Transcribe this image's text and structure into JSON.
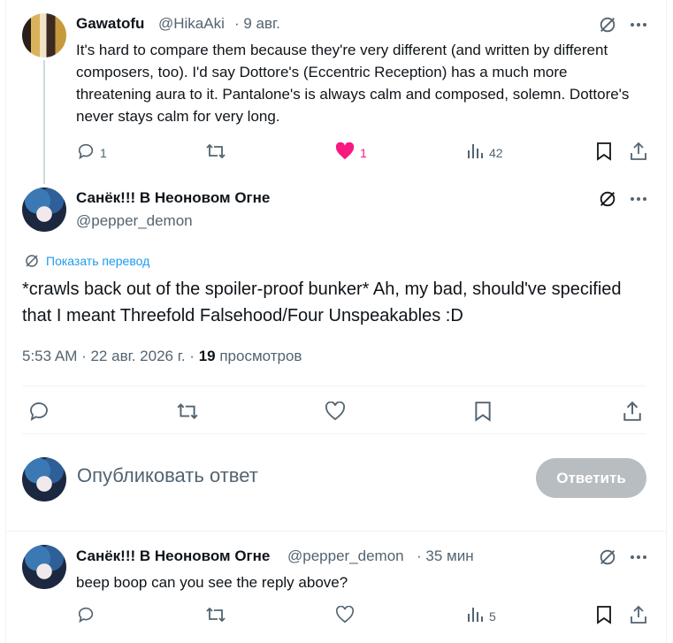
{
  "tweet1": {
    "name": "Gawatofu",
    "handle": "@HikaAki",
    "date": "· 9 авг.",
    "text": "It's hard to compare them because they're very different (and written by different composers, too). I'd say Dottore's (Eccentric Reception) has a much more threatening aura to it. Pantalone's is always calm and composed, solemn. Dottore's never stays calm for very long.",
    "replies": "1",
    "likes": "1",
    "views": "42"
  },
  "main_tweet": {
    "name": "Санёк!!! В Неоновом Огне",
    "handle": "@pepper_demon",
    "translate_label": "Показать перевод",
    "text": "*crawls back out of the spoiler-proof bunker* Ah, my bad, should've specified that I meant Threefold Falsehood/Four Unspeakables :D",
    "timestamp": "5:53 AM · 22 авг. 2026 г. ·",
    "views_count": "19",
    "views_label": "просмотров"
  },
  "composer": {
    "placeholder": "Опубликовать ответ",
    "submit_label": "Ответить"
  },
  "tweet3": {
    "name": "Санёк!!! В Неоновом Огне",
    "handle": "@pepper_demon",
    "date": "· 35 мин",
    "text": "beep boop can you see the reply above?",
    "views": "5"
  },
  "icons": {
    "grok": "grok-icon",
    "more": "more-icon",
    "reply": "reply-icon",
    "retweet": "retweet-icon",
    "like": "heart-icon",
    "views": "views-icon",
    "bookmark": "bookmark-icon",
    "share": "share-icon",
    "translate": "translate-icon"
  },
  "colors": {
    "accent": "#1d9bf0",
    "like": "#f91880",
    "muted": "#536471",
    "button_disabled": "#b8bdc2"
  }
}
